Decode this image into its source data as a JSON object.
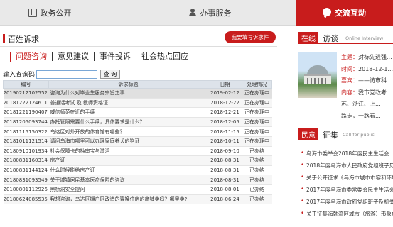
{
  "topnav": {
    "tabs": [
      {
        "label": "政务公开",
        "icon": "book-icon"
      },
      {
        "label": "办事服务",
        "icon": "person-icon"
      },
      {
        "label": "交流互动",
        "icon": "chat-icon"
      }
    ]
  },
  "left": {
    "section_title": "百姓诉求",
    "submit_button": "我要填写诉求件",
    "subtabs": [
      "问题咨询",
      "意见建议",
      "事件投诉",
      "社会热点回应"
    ],
    "active_subtab": "问题咨询",
    "query_label": "输入查询码",
    "query_value": "",
    "query_button": "查 询",
    "columns": [
      "编号",
      "诉求标题",
      "日期",
      "处理情况"
    ],
    "rows": [
      [
        "20190212102552",
        "咨询为什么对毕业生服务宗旨之事",
        "2019-02-12",
        "正在办理中"
      ],
      [
        "20181222124611",
        "普通话考试 及 教师资格证",
        "2018-12-22",
        "正在办理中"
      ],
      [
        "20181221190407",
        "威信师范在迁的手续",
        "2018-12-21",
        "正在办理中"
      ],
      [
        "20181205093744",
        "办托管照需要什么手续，具体要求是什么？",
        "2018-12-05",
        "正在办理中"
      ],
      [
        "20181115150322",
        "乌达区对外开放的体育馆有哪些？",
        "2018-11-15",
        "正在办理中"
      ],
      [
        "20181011121514",
        "请问乌海市哪里可以办理家庭养犬的狗证",
        "2018-10-11",
        "正在办理中"
      ],
      [
        "20180910101934",
        "社会保障卡的抽审宝与激活",
        "2018-09-10",
        "已办结"
      ],
      [
        "20180831160314",
        "房产证",
        "2018-08-31",
        "已办结"
      ],
      [
        "20180831144124",
        "什么时候能给房产证",
        "2018-08-31",
        "已办结"
      ],
      [
        "20180831093549",
        "关于城镇居民基本医疗保险的咨询",
        "2018-08-31",
        "已办结"
      ],
      [
        "20180801112926",
        "黑桥洞安全提问",
        "2018-08-01",
        "已办结"
      ],
      [
        "20180624085535",
        "我想咨询，乌达区棚户区改造的置换住房的商铺卖吗？哪里卖?",
        "2018-06-24",
        "已办结"
      ]
    ]
  },
  "right": {
    "online_label": "在线",
    "interview_label": "访谈",
    "interview_en": "Online Interview",
    "info": [
      {
        "key": "主题：",
        "value": "对标先进强..."
      },
      {
        "key": "时间：",
        "value": "2018-12-1..."
      },
      {
        "key": "嘉宾：",
        "value": "——访市科..."
      },
      {
        "key": "内容：",
        "value": "我市党政考..."
      }
    ],
    "content_lines": [
      "苏、浙江、上...",
      "路走，一路看..."
    ],
    "solicit_label": "民意",
    "collect_label": "征集",
    "solicit_en": "Call for public",
    "news": [
      "乌海市委举会2018年度民主生活会...",
      "2018年度乌海市人民政府党组班子见面...",
      "关于公开征求《乌海市城市市容和环境...",
      "2017年度乌海市委常委会民主生活会...",
      "2017年度乌海市政府党组班子及机关...",
      "关于征集海勃湾区城市（旅游）形象广..."
    ]
  }
}
